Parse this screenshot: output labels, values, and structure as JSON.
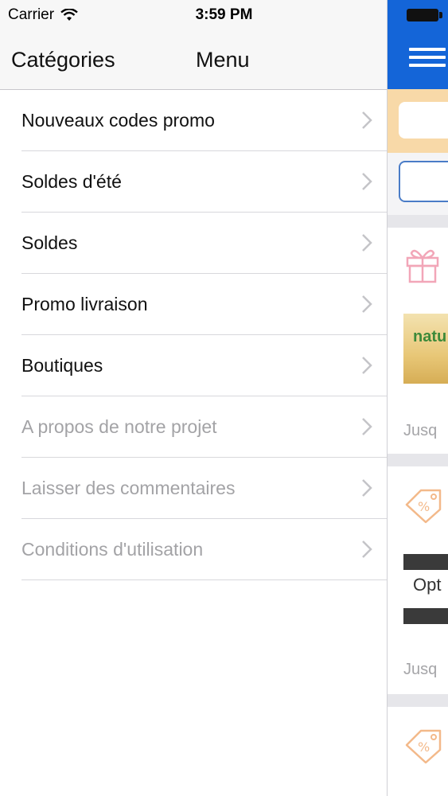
{
  "status_bar": {
    "carrier": "Carrier",
    "time": "3:59 PM"
  },
  "nav": {
    "left": "Catégories",
    "title": "Menu"
  },
  "menu": [
    {
      "label": "Nouveaux codes promo",
      "muted": false
    },
    {
      "label": "Soldes d'été",
      "muted": false
    },
    {
      "label": "Soldes",
      "muted": false
    },
    {
      "label": "Promo livraison",
      "muted": false
    },
    {
      "label": "Boutiques",
      "muted": false
    },
    {
      "label": "A propos de notre projet",
      "muted": true
    },
    {
      "label": "Laisser des commentaires",
      "muted": true
    },
    {
      "label": "Conditions d'utilisation",
      "muted": true
    }
  ],
  "right_pane": {
    "card1_text": "Jusq",
    "card2_text": "Jusq",
    "thumb1_text": "natu",
    "thumb2_text": "Opt",
    "accent_blue": "#1465d8",
    "peach": "#f8d9a8"
  }
}
